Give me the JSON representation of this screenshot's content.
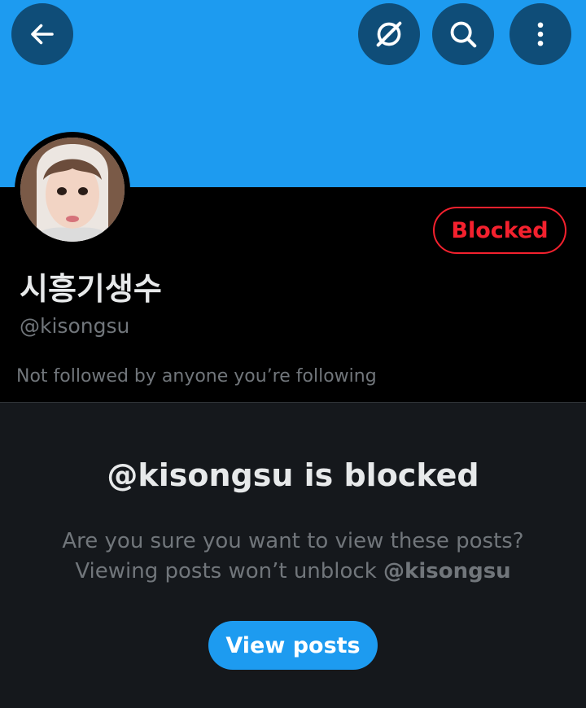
{
  "header": {
    "back_icon": "arrow-left-icon",
    "grok_icon": "grok-icon",
    "search_icon": "search-icon",
    "more_icon": "more-vertical-icon"
  },
  "profile": {
    "display_name": "시흥기생수",
    "handle": "@kisongsu",
    "relationship_status": "Blocked",
    "followers_note": "Not followed by anyone you’re following"
  },
  "blocked_notice": {
    "title": "@kisongsu is blocked",
    "line1": "Are you sure you want to view these posts?",
    "line2_prefix": "Viewing posts won’t unblock ",
    "line2_handle": "@kisongsu",
    "button_label": "View posts"
  },
  "colors": {
    "accent": "#1d9bf0",
    "blocked_red": "#f4212e",
    "background": "#000000",
    "panel": "#15181c"
  }
}
